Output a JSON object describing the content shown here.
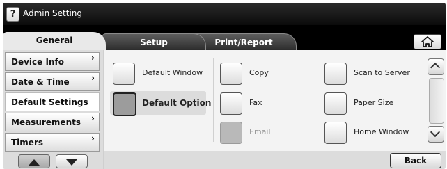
{
  "header": {
    "help_label": "?",
    "title": "Admin Setting"
  },
  "tabs": [
    {
      "label": "General",
      "selected": true
    },
    {
      "label": "Setup",
      "selected": false
    },
    {
      "label": "Print/Report",
      "selected": false
    }
  ],
  "home_icon": "home-icon",
  "sidebar": {
    "items": [
      {
        "label": "Device Info",
        "has_submenu": true
      },
      {
        "label": "Date & Time",
        "has_submenu": true
      },
      {
        "label": "Default Settings",
        "selected": true
      },
      {
        "label": "Measurements",
        "has_submenu": true
      },
      {
        "label": "Timers",
        "has_submenu": true
      }
    ],
    "chevron": "›"
  },
  "options": {
    "col1": [
      {
        "label": "Default Window"
      },
      {
        "label": "Default Option",
        "active": true
      }
    ],
    "col2": [
      {
        "label": "Copy"
      },
      {
        "label": "Fax"
      },
      {
        "label": "Email",
        "disabled": true
      }
    ],
    "col3": [
      {
        "label": "Scan to Server"
      },
      {
        "label": "Paper Size"
      },
      {
        "label": "Home Window"
      }
    ]
  },
  "footer": {
    "back_label": "Back"
  }
}
